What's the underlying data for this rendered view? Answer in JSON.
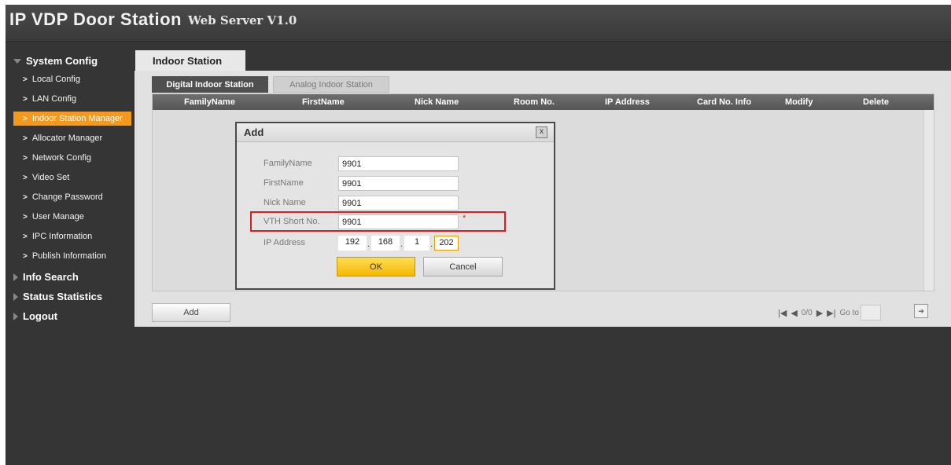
{
  "header": {
    "title": "IP VDP Door Station",
    "subtitle": "Web Server V1.0"
  },
  "sidebar": {
    "system_config": "System Config",
    "items": [
      {
        "label": "Local Config"
      },
      {
        "label": "LAN Config"
      },
      {
        "label": "Indoor Station Manager",
        "active": true
      },
      {
        "label": "Allocator Manager"
      },
      {
        "label": "Network Config"
      },
      {
        "label": "Video Set"
      },
      {
        "label": "Change Password"
      },
      {
        "label": "User Manage"
      },
      {
        "label": "IPC Information"
      },
      {
        "label": "Publish Information"
      }
    ],
    "info_search": "Info Search",
    "status_statistics": "Status Statistics",
    "logout": "Logout"
  },
  "main": {
    "tab": "Indoor Station",
    "subtabs": {
      "digital": "Digital Indoor Station",
      "analog": "Analog Indoor Station"
    },
    "columns": [
      "FamilyName",
      "FirstName",
      "Nick Name",
      "Room No.",
      "IP Address",
      "Card No. Info",
      "Modify",
      "Delete"
    ],
    "add_button": "Add",
    "pager": {
      "page": "0/0",
      "goto_label": "Go to"
    }
  },
  "dialog": {
    "title": "Add",
    "close": "x",
    "fields": {
      "family_name": {
        "label": "FamilyName",
        "value": "9901"
      },
      "first_name": {
        "label": "FirstName",
        "value": "9901"
      },
      "nick_name": {
        "label": "Nick Name",
        "value": "9901"
      },
      "vth_short_no": {
        "label": "VTH Short No.",
        "value": "9901",
        "required": "*"
      },
      "ip_address": {
        "label": "IP Address",
        "octets": [
          "192",
          "168",
          "1",
          "202"
        ]
      }
    },
    "ok": "OK",
    "cancel": "Cancel"
  },
  "colors": {
    "active_nav": "#f39a1e",
    "ok_button": "#f5b800",
    "highlight": "#d42020"
  }
}
